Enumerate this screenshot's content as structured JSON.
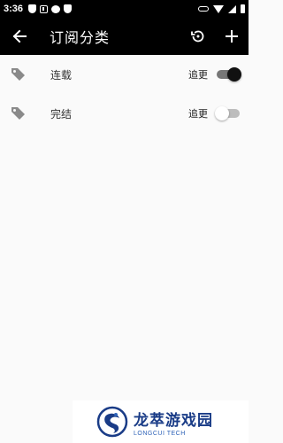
{
  "status_bar": {
    "time": "3:36"
  },
  "app_bar": {
    "title": "订阅分类",
    "back_icon": "arrow-left-icon",
    "history_icon": "history-icon",
    "add_icon": "plus-icon"
  },
  "categories": [
    {
      "label": "连载",
      "follow_label": "追更",
      "follow_on": true
    },
    {
      "label": "完结",
      "follow_label": "追更",
      "follow_on": false
    }
  ],
  "watermark": {
    "name": "龙萃游戏园",
    "subtitle": "LONGCUI TECH"
  },
  "colors": {
    "app_bar": "#000000",
    "background": "#fafafa",
    "switch_on": "#111111",
    "watermark_blue": "#1a3c87"
  }
}
